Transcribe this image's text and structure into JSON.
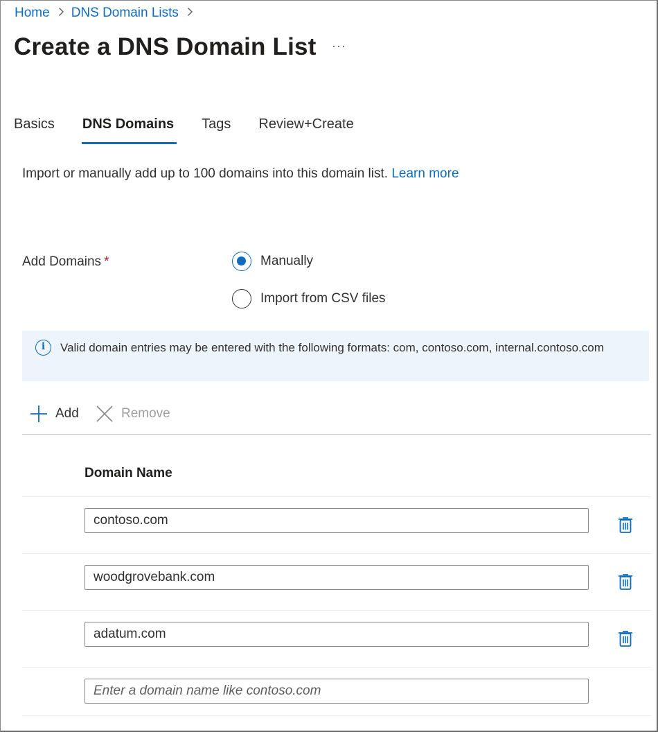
{
  "breadcrumb": {
    "items": [
      "Home",
      "DNS Domain Lists"
    ]
  },
  "page": {
    "title": "Create a DNS Domain List",
    "more_label": "···"
  },
  "tabs": [
    {
      "label": "Basics",
      "active": false
    },
    {
      "label": "DNS Domains",
      "active": true
    },
    {
      "label": "Tags",
      "active": false
    },
    {
      "label": "Review+Create",
      "active": false
    }
  ],
  "description": {
    "text": "Import or manually add up to 100 domains into this domain list.",
    "link": "Learn more"
  },
  "add_domains": {
    "label": "Add Domains",
    "required_marker": "*",
    "options": [
      {
        "label": "Manually",
        "selected": true
      },
      {
        "label": "Import from CSV files",
        "selected": false
      }
    ]
  },
  "info": {
    "icon": "info-icon",
    "text": "Valid domain entries may be entered with the following formats: com, contoso.com, internal.contoso.com"
  },
  "toolbar": {
    "add_label": "Add",
    "remove_label": "Remove"
  },
  "table": {
    "column_header": "Domain Name",
    "rows": [
      {
        "value": "contoso.com"
      },
      {
        "value": "woodgrovebank.com"
      },
      {
        "value": "adatum.com"
      }
    ],
    "new_row_placeholder": "Enter a domain name like contoso.com"
  },
  "colors": {
    "accent": "#0f6cbd",
    "required": "#a4262c",
    "info_bg": "#eef4fb",
    "disabled": "#a19f9d"
  }
}
